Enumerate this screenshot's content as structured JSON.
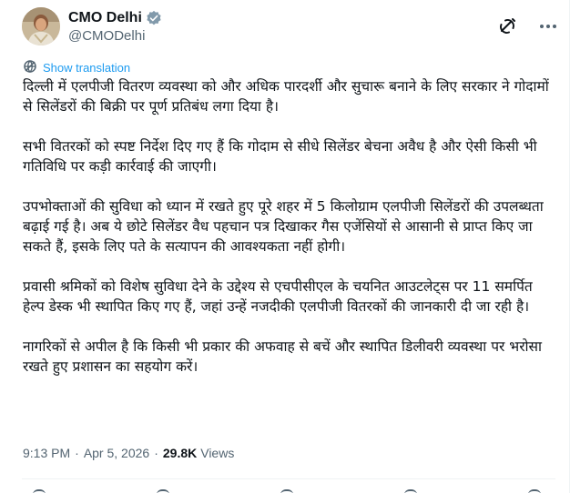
{
  "author": {
    "display_name": "CMO Delhi",
    "handle": "@CMODelhi",
    "verified_badge_color": "#829aab"
  },
  "translation": {
    "label": "Show translation"
  },
  "tweet": {
    "paragraphs": [
      "दिल्ली में एलपीजी वितरण व्यवस्था को और अधिक पारदर्शी और सुचारू बनाने के लिए सरकार ने गोदामों से सिलेंडरों की बिक्री पर पूर्ण प्रतिबंध लगा दिया है।",
      "सभी वितरकों को स्पष्ट निर्देश दिए गए हैं कि गोदाम से सीधे सिलेंडर बेचना अवैध है और ऐसी किसी भी गतिविधि पर कड़ी कार्रवाई की जाएगी।",
      "उपभोक्ताओं की सुविधा को ध्यान में रखते हुए पूरे शहर में 5 किलोग्राम एलपीजी सिलेंडरों की उपलब्धता बढ़ाई गई है। अब ये छोटे सिलेंडर वैध पहचान पत्र दिखाकर गैस एजेंसियों से आसानी से प्राप्त किए जा सकते हैं, इसके लिए पते के सत्यापन की आवश्यकता नहीं होगी।",
      "प्रवासी श्रमिकों को विशेष सुविधा देने के उद्देश्य से एचपीसीएल के चयनित आउटलेट्स पर 11 समर्पित हेल्प डेस्क भी स्थापित किए गए हैं, जहां उन्हें नजदीकी एलपीजी वितरकों की जानकारी दी जा रही है।",
      "नागरिकों से अपील है कि किसी भी प्रकार की अफवाह से बचें और स्थापित डिलीवरी व्यवस्था पर भरोसा रखते हुए प्रशासन का सहयोग करें।"
    ]
  },
  "meta": {
    "time": "9:13 PM",
    "separator": "·",
    "date": "Apr 5, 2026",
    "views_count": "29.8K",
    "views_label": "Views"
  },
  "icons": {
    "avatar": "avatar-photo",
    "verified": "verified-badge-icon",
    "grok": "grok-icon",
    "more": "more-options-icon",
    "translate": "globe-icon"
  },
  "colors": {
    "text_primary": "#0f1419",
    "text_secondary": "#536471",
    "link": "#1d9bf0",
    "divider": "#eff3f4"
  }
}
